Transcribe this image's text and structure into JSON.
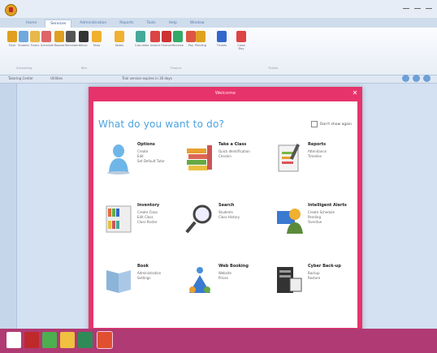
{
  "window": {
    "title": ""
  },
  "ribbon": {
    "tabs": [
      {
        "label": "Home"
      },
      {
        "label": "Services"
      },
      {
        "label": "Administration"
      },
      {
        "label": "Reports"
      },
      {
        "label": "Tools"
      },
      {
        "label": "Help"
      },
      {
        "label": "Window"
      }
    ],
    "active_tab_index": 1,
    "buttons": [
      {
        "label": "Tutor",
        "icon": "person-icon",
        "color": "#e0a020"
      },
      {
        "label": "Student",
        "icon": "student-icon",
        "color": "#6fa8dc"
      },
      {
        "label": "Tutors",
        "icon": "people-icon",
        "color": "#e8b84a"
      },
      {
        "label": "Schedule",
        "icon": "calendar-icon",
        "color": "#d66"
      },
      {
        "label": "Repeat",
        "icon": "repeat-icon",
        "color": "#e0a020"
      },
      {
        "label": "Reminders",
        "icon": "bell-icon",
        "color": "#555"
      },
      {
        "label": "Music",
        "icon": "note-icon",
        "color": "#333"
      },
      {
        "label": "Tests",
        "icon": "folder-icon",
        "color": "#f0b030"
      },
      {
        "label": "Notes",
        "icon": "folder-icon",
        "color": "#f0b030"
      },
      {
        "label": "Calculator",
        "icon": "calc-icon",
        "color": "#4a9"
      },
      {
        "label": "Invoice",
        "icon": "invoice-icon",
        "color": "#d44"
      },
      {
        "label": "Finance",
        "icon": "chart-icon",
        "color": "#c33"
      },
      {
        "label": "Receive",
        "icon": "money-icon",
        "color": "#3a6"
      },
      {
        "label": "Pay",
        "icon": "card-icon",
        "color": "#d54"
      },
      {
        "label": "Pending",
        "icon": "clock-icon",
        "color": "#e0a020"
      },
      {
        "label": "Tickets",
        "icon": "ticket-icon",
        "color": "#36c"
      },
      {
        "label": "Close Day",
        "icon": "close-icon",
        "color": "#d44"
      }
    ],
    "groups": [
      {
        "label": "Scheduling"
      },
      {
        "label": "Bills"
      },
      {
        "label": "Finance"
      },
      {
        "label": "Tickets"
      }
    ]
  },
  "statusbar": {
    "left": "Tutoring Center",
    "mid": "Utilities",
    "right": "Trial version expires in 30 days"
  },
  "dialog": {
    "title": "Welcome",
    "heading": "What do you want to do?",
    "dont_show": "Don't show again",
    "options": [
      {
        "title": "Options",
        "lines": [
          "Create",
          "Edit",
          "Set Default Tutor"
        ],
        "icon": "person-icon",
        "color": "#6fb6e8"
      },
      {
        "title": "Take a Class",
        "lines": [
          "Quick Identification",
          "Checkin"
        ],
        "icon": "books-icon",
        "color": "#e8a030"
      },
      {
        "title": "Reports",
        "lines": [
          "Attendance",
          "Timeline"
        ],
        "icon": "report-icon",
        "color": "#7ab648"
      },
      {
        "title": "Inventory",
        "lines": [
          "Create Class",
          "Edit Class",
          "Class Roster"
        ],
        "icon": "bookshelf-icon",
        "color": "#e06b3c"
      },
      {
        "title": "Search",
        "lines": [
          "Students",
          "Class History"
        ],
        "icon": "magnifier-icon",
        "color": "#444444"
      },
      {
        "title": "Intelligent Alerts",
        "lines": [
          "Create Schedule",
          "Pending",
          "Overdue"
        ],
        "icon": "alert-person-icon",
        "color": "#f0b030"
      },
      {
        "title": "Book",
        "lines": [
          "Administration",
          "Settings"
        ],
        "icon": "book-icon",
        "color": "#8ab4d8"
      },
      {
        "title": "Web Booking",
        "lines": [
          "Website",
          "Prices"
        ],
        "icon": "web-icon",
        "color": "#4a90d9"
      },
      {
        "title": "Cyber Back-up",
        "lines": [
          "Backup",
          "Restore"
        ],
        "icon": "server-icon",
        "color": "#333333"
      }
    ]
  },
  "taskbar": {
    "items": [
      {
        "icon": "start-icon",
        "color": "#ffffff"
      },
      {
        "icon": "app-icon",
        "color": "#c0292b"
      },
      {
        "icon": "chrome-icon",
        "color": "#4caf50"
      },
      {
        "icon": "folder-icon",
        "color": "#f0c040"
      },
      {
        "icon": "browser-icon",
        "color": "#2e8b57"
      },
      {
        "icon": "app-active-icon",
        "color": "#e05030"
      }
    ],
    "tray_time": "",
    "tray_date": ""
  }
}
